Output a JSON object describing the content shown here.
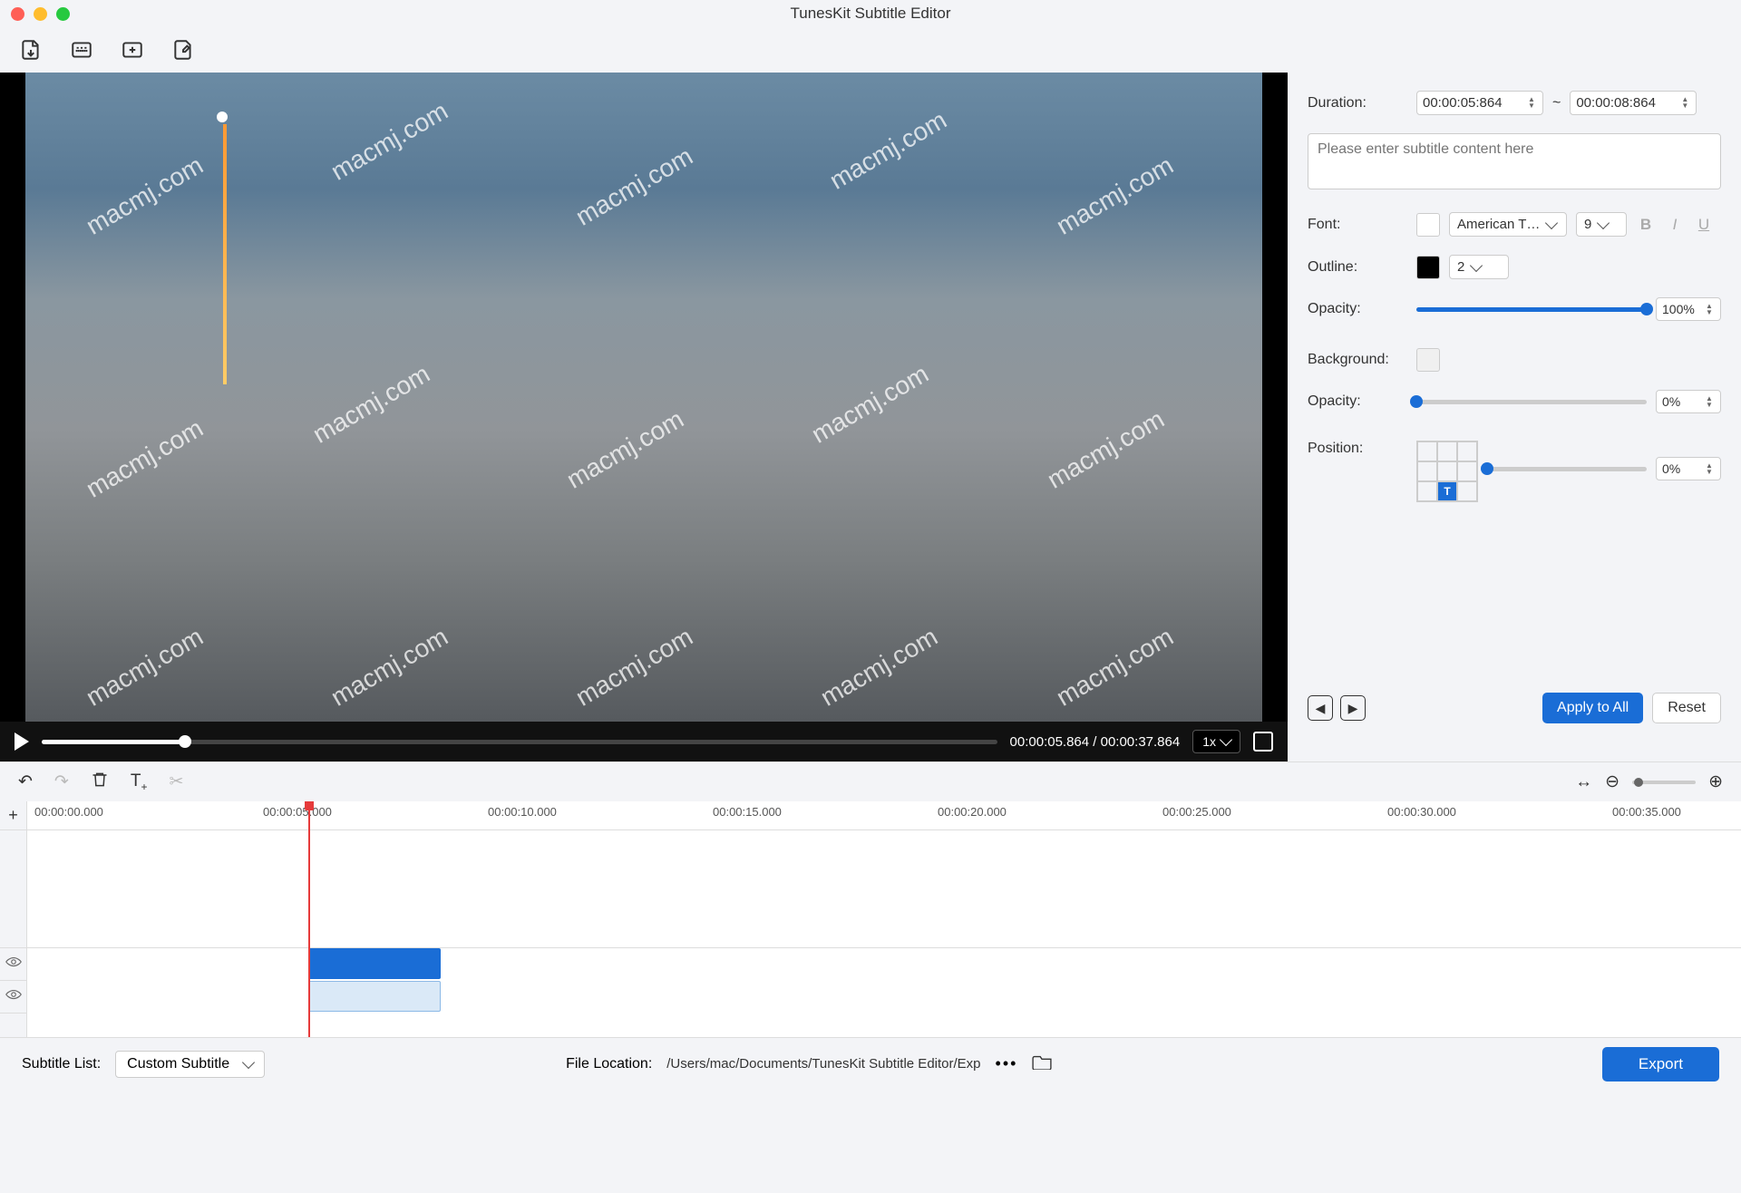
{
  "app": {
    "title": "TunesKit Subtitle Editor"
  },
  "video": {
    "current_time": "00:00:05.864",
    "total_time": "00:00:37.864",
    "time_display": "00:00:05.864 / 00:00:37.864",
    "speed": "1x"
  },
  "props": {
    "duration_label": "Duration:",
    "duration_start": "00:00:05:864",
    "duration_end": "00:00:08:864",
    "duration_sep": "~",
    "content_placeholder": "Please enter subtitle content here",
    "font_label": "Font:",
    "font_family": "American T…",
    "font_size": "9",
    "outline_label": "Outline:",
    "outline_color": "#000000",
    "outline_width": "2",
    "opacity_label": "Opacity:",
    "opacity_value": "100%",
    "background_label": "Background:",
    "bg_opacity_label": "Opacity:",
    "bg_opacity_value": "0%",
    "position_label": "Position:",
    "position_value": "0%",
    "apply_label": "Apply to All",
    "reset_label": "Reset"
  },
  "timeline": {
    "ticks": [
      "00:00:00.000",
      "00:00:05.000",
      "00:00:10.000",
      "00:00:15.000",
      "00:00:20.000",
      "00:00:25.000",
      "00:00:30.000",
      "00:00:35.000"
    ]
  },
  "bottom": {
    "subtitle_list_label": "Subtitle List:",
    "subtitle_list_value": "Custom Subtitle",
    "file_location_label": "File Location:",
    "file_location_value": "/Users/mac/Documents/TunesKit Subtitle Editor/Exp",
    "export_label": "Export"
  }
}
